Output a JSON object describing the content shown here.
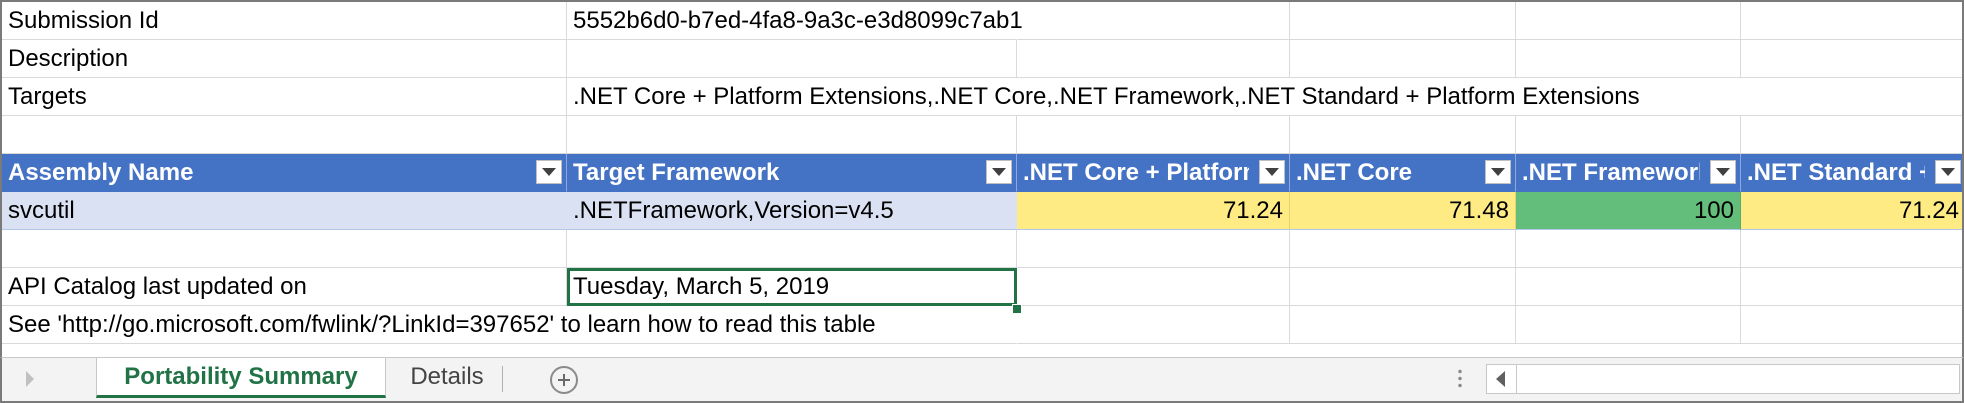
{
  "meta": {
    "submission_id_label": "Submission Id",
    "submission_id_value": "5552b6d0-b7ed-4fa8-9a3c-e3d8099c7ab1",
    "description_label": "Description",
    "description_value": "",
    "targets_label": "Targets",
    "targets_value": ".NET Core + Platform Extensions,.NET Core,.NET Framework,.NET Standard + Platform Extensions"
  },
  "table": {
    "headers": [
      "Assembly Name",
      "Target Framework",
      ".NET Core + Platform Extensions",
      ".NET Core",
      ".NET Framework",
      ".NET Standard + Platform Extensions"
    ],
    "rows": [
      {
        "assembly": "svcutil",
        "framework": ".NETFramework,Version=v4.5",
        "values": [
          "71.24",
          "71.48",
          "100",
          "71.24"
        ]
      }
    ]
  },
  "footer": {
    "api_catalog_label": "API Catalog last updated on",
    "api_catalog_value": "Tuesday, March 5, 2019",
    "note": "See 'http://go.microsoft.com/fwlink/?LinkId=397652' to learn how to read this table"
  },
  "tabs": {
    "active": "Portability Summary",
    "other": "Details"
  },
  "colors": {
    "header_bg": "#4472c4",
    "row_bg": "#d9e1f2",
    "yellow_scale": "#ffeb84",
    "green_scale": "#63be7b",
    "accent": "#217346"
  },
  "icons": {
    "filter": "filter-dropdown-icon",
    "add_sheet": "add-sheet-icon",
    "scroll_left": "scroll-left-icon"
  }
}
